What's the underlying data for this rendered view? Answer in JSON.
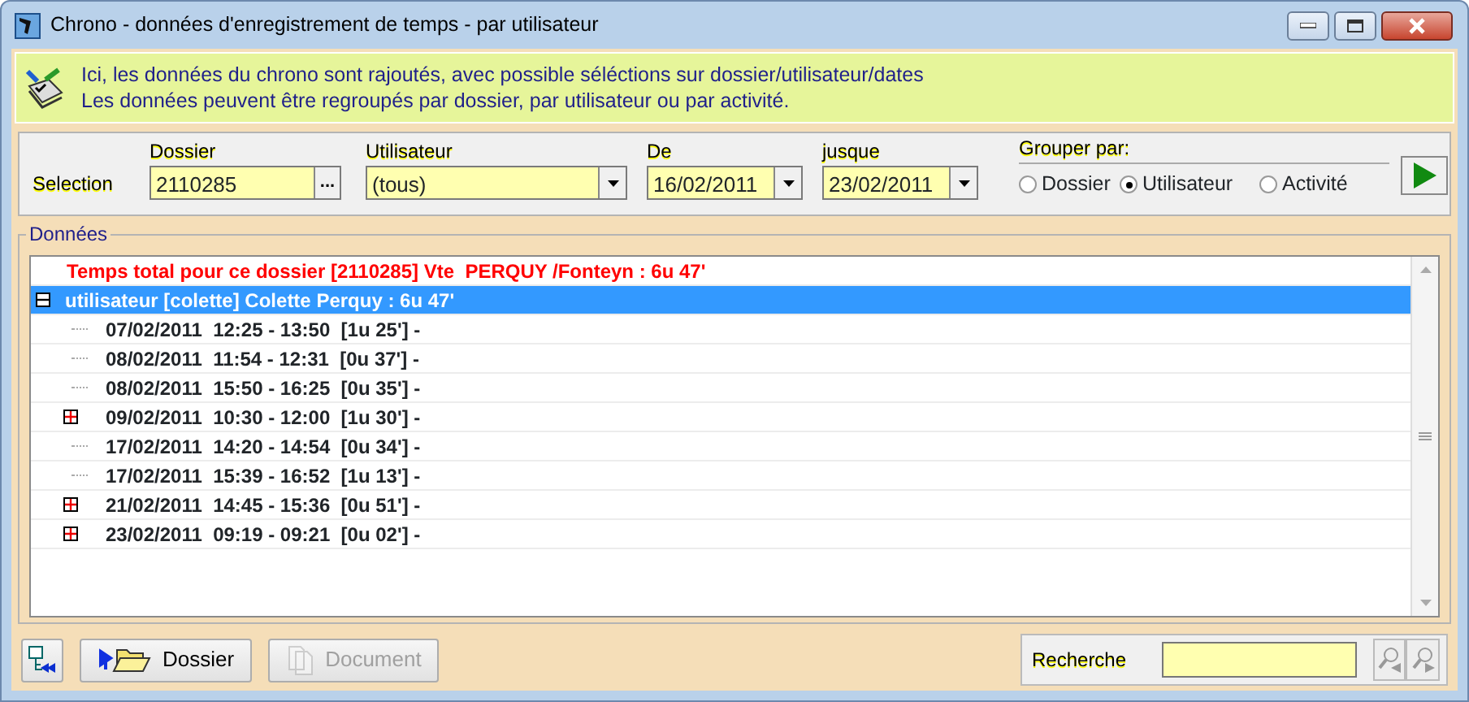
{
  "window": {
    "title": "Chrono - données d'enregistrement de temps - par utilisateur"
  },
  "info": {
    "lines": [
      "Ici, les données du chrono sont rajoutés, avec possible séléctions sur dossier/utilisateur/dates",
      "Les données peuvent être regroupés par dossier, par utilisateur ou par activité."
    ]
  },
  "selection": {
    "label": "Selection",
    "fields": [
      {
        "kind": "lookup",
        "label": "Dossier",
        "value": "2110285",
        "button": "..."
      },
      {
        "kind": "combo",
        "label": "Utilisateur",
        "value": "(tous)"
      },
      {
        "kind": "date",
        "label": "De",
        "value": "16/02/2011"
      },
      {
        "kind": "date",
        "label": "jusque",
        "value": "23/02/2011"
      }
    ],
    "group_by": {
      "label": "Grouper par:",
      "options": [
        {
          "label": "Dossier",
          "selected": false
        },
        {
          "label": "Utilisateur",
          "selected": true
        },
        {
          "label": "Activité",
          "selected": false
        }
      ]
    }
  },
  "data": {
    "legend": "Données",
    "total": "Temps total pour ce dossier [2110285] Vte  PERQUY /Fonteyn : 6u 47'",
    "groups": [
      {
        "label": "utilisateur [colette] Colette Perquy : 6u 47'",
        "expanded": true,
        "selected": true,
        "children": [
          {
            "kind": "leaf",
            "label": "07/02/2011  12:25 - 13:50  [1u 25'] -"
          },
          {
            "kind": "leaf",
            "label": "08/02/2011  11:54 - 12:31  [0u 37'] -"
          },
          {
            "kind": "leaf",
            "label": "08/02/2011  15:50 - 16:25  [0u 35'] -"
          },
          {
            "kind": "node",
            "expanded": false,
            "label": "09/02/2011  10:30 - 12:00  [1u 30'] -"
          },
          {
            "kind": "leaf",
            "label": "17/02/2011  14:20 - 14:54  [0u 34'] -"
          },
          {
            "kind": "leaf",
            "label": "17/02/2011  15:39 - 16:52  [1u 13'] -"
          },
          {
            "kind": "node",
            "expanded": false,
            "label": "21/02/2011  14:45 - 15:36  [0u 51'] -"
          },
          {
            "kind": "node",
            "expanded": false,
            "label": "23/02/2011  09:19 - 09:21  [0u 02'] -"
          }
        ]
      }
    ]
  },
  "footer": {
    "buttons": [
      {
        "kind": "icon",
        "disabled": false
      },
      {
        "kind": "folder",
        "label": "Dossier",
        "disabled": false
      },
      {
        "kind": "document",
        "label": "Document",
        "disabled": true
      }
    ],
    "search": {
      "label": "Recherche"
    }
  }
}
